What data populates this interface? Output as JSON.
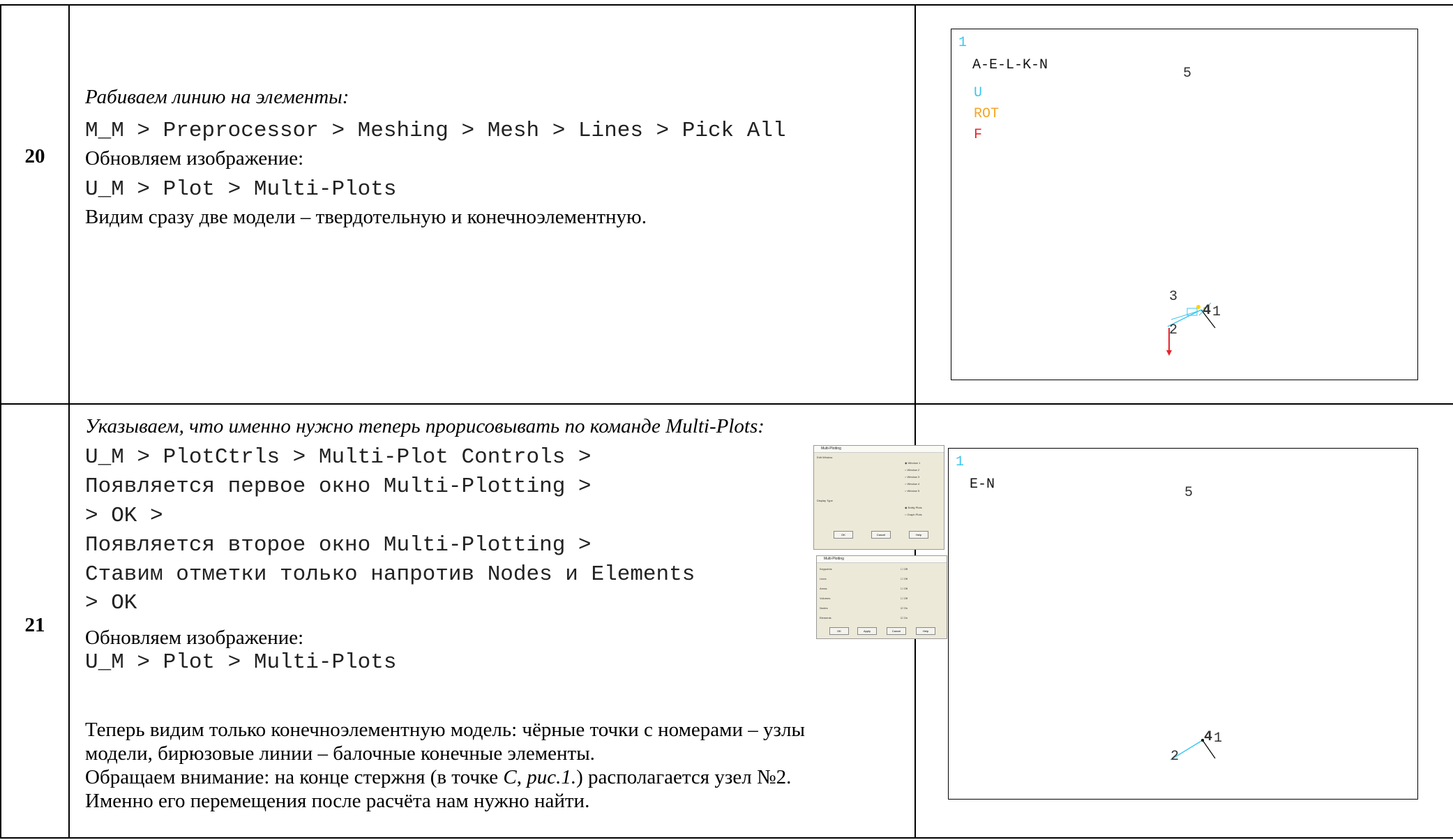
{
  "step20": {
    "number": "20",
    "heading": "Рабиваем линию на элементы:",
    "cmd1": "M_M > Preprocessor > Meshing > Mesh > Lines > Pick All",
    "refresh": "Обновляем изображение:",
    "cmd2": "U_M > Plot > Multi-Plots",
    "note": "Видим сразу две модели – твердотельную и конечноэлементную.",
    "plot": {
      "win_no": "1",
      "title": "A-E-L-K-N",
      "legend": [
        {
          "label": "U",
          "color": "#3dc7ef"
        },
        {
          "label": "ROT",
          "color": "#f5a623"
        },
        {
          "label": "F",
          "color": "#e8242b"
        }
      ],
      "labels": {
        "l5": "5",
        "l3": "3",
        "l2": "2",
        "l1": "1",
        "l4": "4"
      }
    }
  },
  "step21": {
    "number": "21",
    "heading": "Указываем, что именно нужно теперь прорисовывать по команде Multi-Plots:",
    "cmd_lines": [
      "U_M > PlotCtrls > Multi-Plot Controls >",
      "Появляется первое окно Multi-Plotting >",
      "> OK >",
      "Появляется второе окно Multi-Plotting >",
      "Ставим отметки только напротив Nodes и Elements",
      "> OK"
    ],
    "refresh": "Обновляем изображение:",
    "cmd2": "U_M > Plot > Multi-Plots",
    "notes": [
      "Теперь видим только конечноэлементную модель: чёрные точки с номерами – узлы",
      "модели, бирюзовые линии – балочные конечные элементы."
    ],
    "note3_a": "Обращаем внимание: на конце стержня (в точке ",
    "note3_c": "C",
    "note3_b": ", ",
    "note3_fig": "рис.1.",
    "note3_d": ") располагается узел №2.",
    "note4": "Именно его перемещения после расчёта нам нужно найти.",
    "plot": {
      "win_no": "1",
      "title": "E-N",
      "labels": {
        "l5": "5",
        "l2": "2",
        "l1": "1",
        "l4": "4"
      }
    },
    "dialog1": {
      "title": "Multi-Plotting",
      "section1": "Edit Window",
      "options1": [
        "Window 1",
        "Window 2",
        "Window 3",
        "Window 4",
        "Window 5"
      ],
      "section2": "Display Type",
      "options2": [
        "Entity Plots",
        "Graph Plots"
      ],
      "buttons": [
        "OK",
        "Cancel",
        "Help"
      ]
    },
    "dialog2": {
      "title": "Multi-Plotting",
      "rows": [
        {
          "label": "Keypoints",
          "value": "Off"
        },
        {
          "label": "Lines",
          "value": "Off"
        },
        {
          "label": "Areas",
          "value": "Off"
        },
        {
          "label": "Volumes",
          "value": "Off"
        },
        {
          "label": "Nodes",
          "value": "On"
        },
        {
          "label": "Elements",
          "value": "On"
        }
      ],
      "buttons": [
        "OK",
        "Apply",
        "Cancel",
        "Help"
      ]
    }
  }
}
